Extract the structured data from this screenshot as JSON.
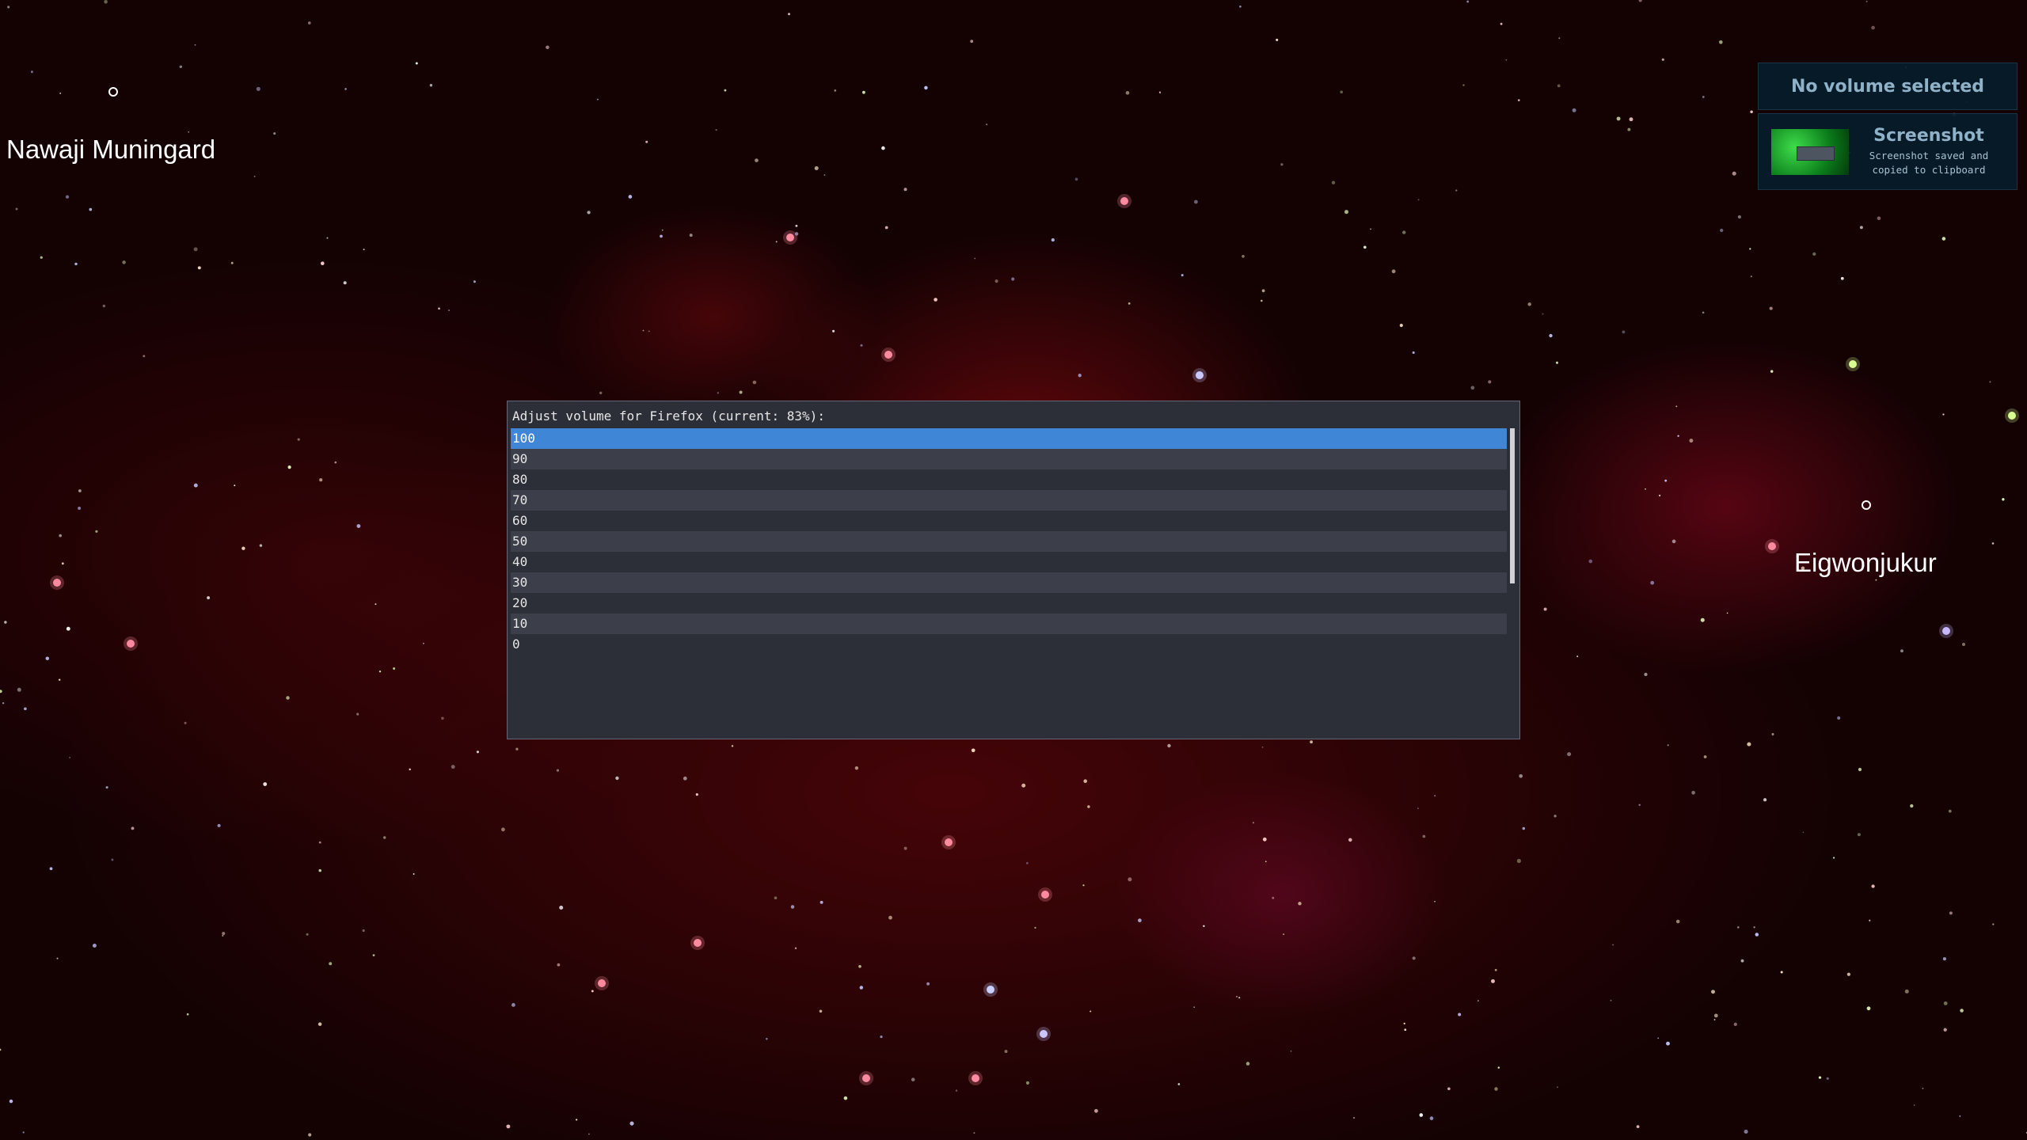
{
  "desktop": {
    "places": [
      {
        "name": "Nawaji Muningard"
      },
      {
        "name": "Eigwonjukur"
      }
    ]
  },
  "notifications": {
    "volume": {
      "text": "No volume selected"
    },
    "screenshot": {
      "title": "Screenshot",
      "body_line1": "Screenshot saved and",
      "body_line2": "copied to clipboard",
      "thumbnail_icon": "screenshot-thumbnail"
    }
  },
  "menu": {
    "prompt": "Adjust volume for Firefox (current: 83%):",
    "items": [
      "100",
      "90",
      "80",
      "70",
      "60",
      "50",
      "40",
      "30",
      "20",
      "10",
      "0"
    ],
    "selected_index": 0,
    "colors": {
      "selected": "#3f86d6",
      "background": "#2c2e38",
      "alternate_row": "#3c3f4a"
    }
  }
}
